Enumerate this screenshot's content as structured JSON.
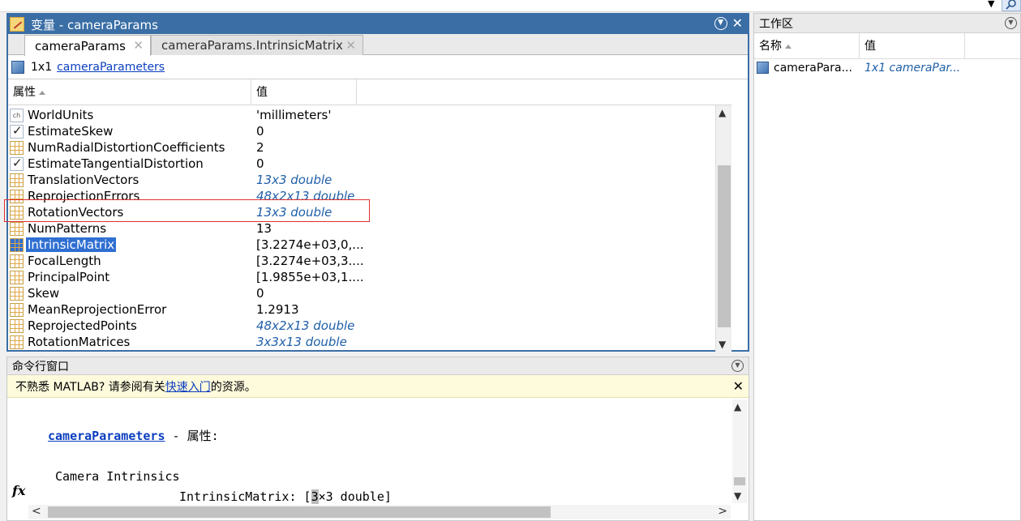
{
  "colors": {
    "accent": "#3a6ea5",
    "selection": "#2f6fd2",
    "link": "#0b3fc0",
    "highlight_box": "#e03030",
    "note_bg": "#fefadc"
  },
  "variable_editor": {
    "title": "变量 - cameraParams",
    "tabs": [
      {
        "label": "cameraParams",
        "active": true
      },
      {
        "label": "cameraParams.IntrinsicMatrix",
        "active": false
      }
    ],
    "info": {
      "size": "1x1",
      "class_link": "cameraParameters"
    },
    "columns": {
      "name": "属性",
      "value": "值"
    },
    "rows": [
      {
        "icon": "char-icon",
        "name": "WorldUnits",
        "value": "'millimeters'",
        "link": false
      },
      {
        "icon": "checkbox-icon",
        "name": "EstimateSkew",
        "value": "0",
        "link": false
      },
      {
        "icon": "grid-icon",
        "name": "NumRadialDistortionCoefficients",
        "value": "2",
        "link": false
      },
      {
        "icon": "checkbox-icon",
        "name": "EstimateTangentialDistortion",
        "value": "0",
        "link": false
      },
      {
        "icon": "grid-icon",
        "name": "TranslationVectors",
        "value": "13x3 double",
        "link": true
      },
      {
        "icon": "grid-icon",
        "name": "ReprojectionErrors",
        "value": "48x2x13 double",
        "link": true
      },
      {
        "icon": "grid-icon",
        "name": "RotationVectors",
        "value": "13x3 double",
        "link": true
      },
      {
        "icon": "grid-icon",
        "name": "NumPatterns",
        "value": "13",
        "link": false
      },
      {
        "icon": "grid-icon",
        "name": "IntrinsicMatrix",
        "value": "[3.2274e+03,0,...",
        "link": false,
        "selected": true
      },
      {
        "icon": "grid-icon",
        "name": "FocalLength",
        "value": "[3.2274e+03,3....",
        "link": false
      },
      {
        "icon": "grid-icon",
        "name": "PrincipalPoint",
        "value": "[1.9855e+03,1....",
        "link": false
      },
      {
        "icon": "grid-icon",
        "name": "Skew",
        "value": "0",
        "link": false
      },
      {
        "icon": "grid-icon",
        "name": "MeanReprojectionError",
        "value": "1.2913",
        "link": false
      },
      {
        "icon": "grid-icon",
        "name": "ReprojectedPoints",
        "value": "48x2x13 double",
        "link": true
      },
      {
        "icon": "grid-icon",
        "name": "RotationMatrices",
        "value": "3x3x13 double",
        "link": true
      }
    ]
  },
  "command_window": {
    "title": "命令行窗口",
    "note_prefix": "不熟悉 MATLAB? 请参阅有关",
    "note_link": "快速入门",
    "note_suffix": "的资源。",
    "line1_link": "cameraParameters",
    "line1_rest": " - 属性:",
    "line2": "Camera Intrinsics",
    "line3_prefix": "IntrinsicMatrix: [",
    "line3_cursor": "3",
    "line3_suffix": "×3 double]",
    "fx": "fx"
  },
  "workspace": {
    "title": "工作区",
    "columns": {
      "name": "名称",
      "value": "值"
    },
    "rows": [
      {
        "name": "cameraPara...",
        "value": "1x1 cameraPar..."
      }
    ]
  }
}
